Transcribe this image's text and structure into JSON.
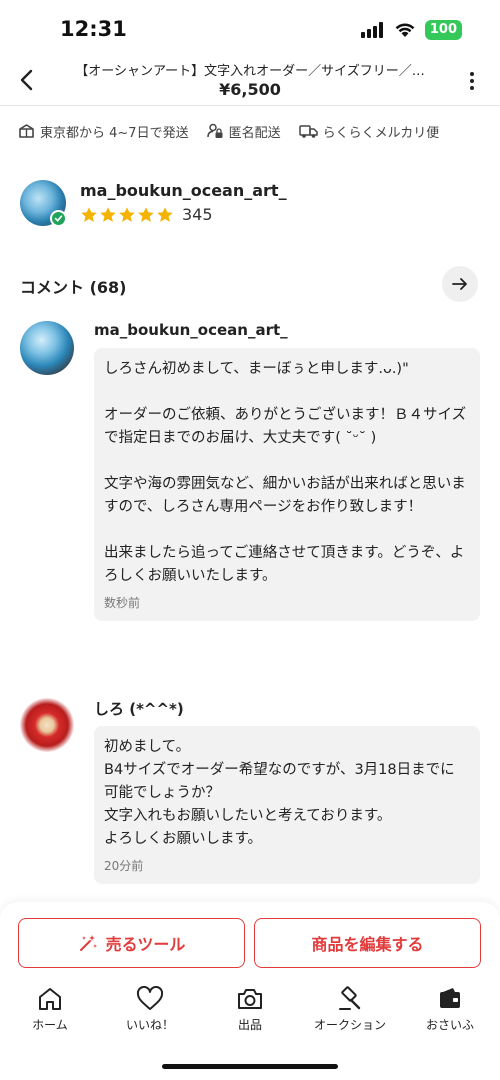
{
  "status_bar": {
    "time": "12:31",
    "battery": "100"
  },
  "header": {
    "title": "【オーシャンアート】文字入れオーダー／サイズフリー／…",
    "price": "¥6,500"
  },
  "shipping": {
    "origin": "東京都から 4~7日で発送",
    "anonymous": "匿名配送",
    "method": "らくらくメルカリ便"
  },
  "seller": {
    "name": "ma_boukun_ocean_art_",
    "rating_count": "345",
    "stars": 5
  },
  "comments": {
    "title": "コメント (68)",
    "items": [
      {
        "author": "ma_boukun_ocean_art_",
        "text": "しろさん初めまして、まーぼぅと申します.ᴗ.)\"\n\nオーダーのご依頼、ありがとうございます！Ｂ４サイズで指定日までのお届け、大丈夫です( ˘ᵕ˘ )\n\n文字や海の雰囲気など、細かいお話が出来ればと思いますので、しろさん専用ページをお作り致します！\n\n出来ましたら追ってご連絡させて頂きます。どうぞ、よろしくお願いいたします。",
        "time": "数秒前"
      },
      {
        "author": "しろ (*^^*)",
        "text": "初めまして。\nB4サイズでオーダー希望なのですが、3月18日までに可能でしょうか？\n文字入れもお願いしたいと考えております。\nよろしくお願いします。",
        "time": "20分前"
      }
    ]
  },
  "actions": {
    "sell_tool": "売るツール",
    "edit_item": "商品を編集する"
  },
  "tabbar": {
    "home": "ホーム",
    "likes": "いいね！",
    "sell": "出品",
    "auction": "オークション",
    "wallet": "おさいふ"
  },
  "colors": {
    "accent": "#e23b3b",
    "star": "#f5b301",
    "verified": "#1fa35a",
    "battery": "#34c759"
  }
}
